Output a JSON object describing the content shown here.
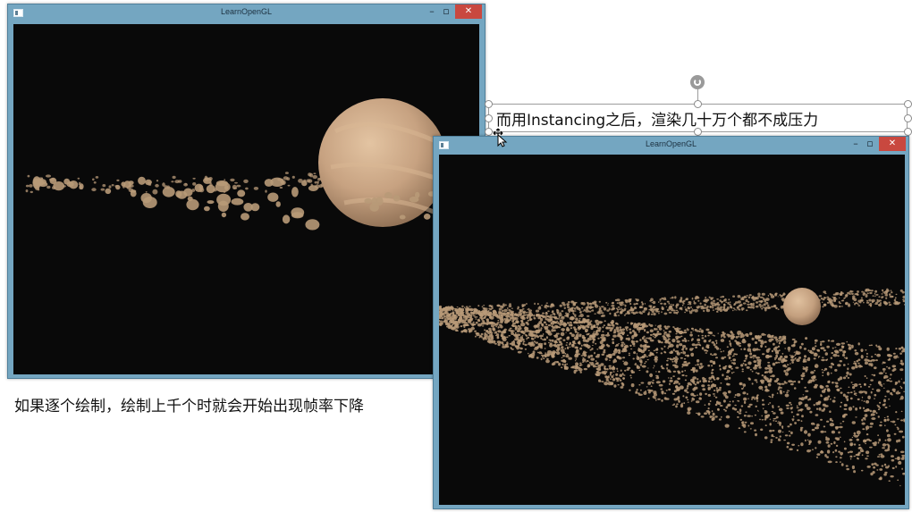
{
  "window_left": {
    "title": "LearnOpenGL",
    "minimize_glyph": "–",
    "maximize_glyph": "▫",
    "close_glyph": "✕"
  },
  "window_right": {
    "title": "LearnOpenGL",
    "minimize_glyph": "–",
    "maximize_glyph": "▫",
    "close_glyph": "✕"
  },
  "captions": {
    "top_right": "而用Instancing之后，渲染几十万个都不成压力",
    "bottom_left": "如果逐个绘制，绘制上千个时就会开始出现帧率下降"
  },
  "colors": {
    "window_frame": "#74a6c1",
    "close_button": "#c9483f",
    "viewport_bg": "#090909",
    "asteroid": "#b89a78",
    "planet": "#c7a281"
  },
  "icons": [
    "app-icon",
    "minimize-icon",
    "maximize-icon",
    "close-icon",
    "rotate-handle-icon",
    "move-cursor-icon"
  ]
}
